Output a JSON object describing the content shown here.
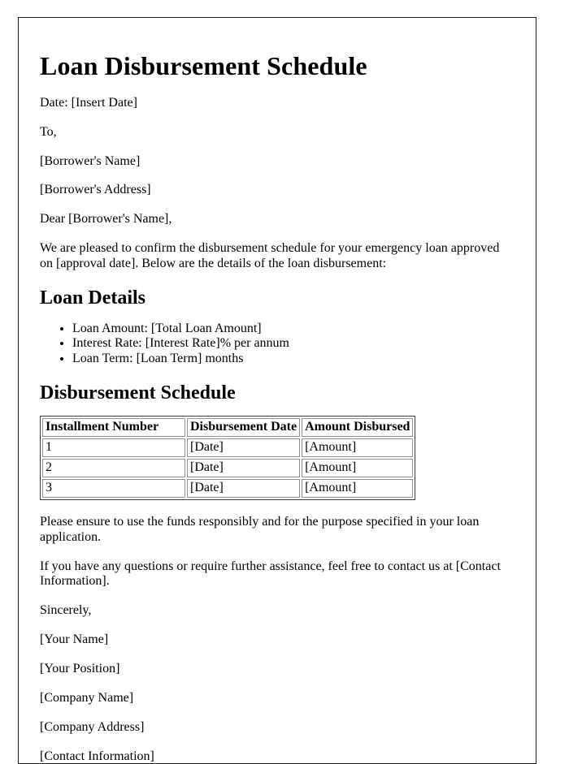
{
  "document": {
    "title": "Loan Disbursement Schedule",
    "date_line": "Date: [Insert Date]",
    "salutation_to": "To,",
    "borrower_name": "[Borrower's Name]",
    "borrower_address": "[Borrower's Address]",
    "greeting": "Dear [Borrower's Name],",
    "intro_paragraph": "We are pleased to confirm the disbursement schedule for your emergency loan approved on [approval date]. Below are the details of the loan disbursement:",
    "loan_details": {
      "heading": "Loan Details",
      "items": [
        "Loan Amount: [Total Loan Amount]",
        "Interest Rate: [Interest Rate]% per annum",
        "Loan Term: [Loan Term] months"
      ]
    },
    "disbursement_schedule": {
      "heading": "Disbursement Schedule",
      "columns": [
        "Installment Number",
        "Disbursement Date",
        "Amount Disbursed"
      ],
      "rows": [
        [
          "1",
          "[Date]",
          "[Amount]"
        ],
        [
          "2",
          "[Date]",
          "[Amount]"
        ],
        [
          "3",
          "[Date]",
          "[Amount]"
        ]
      ]
    },
    "closing_paragraph_1": "Please ensure to use the funds responsibly and for the purpose specified in your loan application.",
    "closing_paragraph_2": "If you have any questions or require further assistance, feel free to contact us at [Contact Information].",
    "signature": {
      "sincerely": "Sincerely,",
      "your_name": "[Your Name]",
      "your_position": "[Your Position]",
      "company_name": "[Company Name]",
      "company_address": "[Company Address]",
      "contact_information": "[Contact Information]"
    }
  }
}
